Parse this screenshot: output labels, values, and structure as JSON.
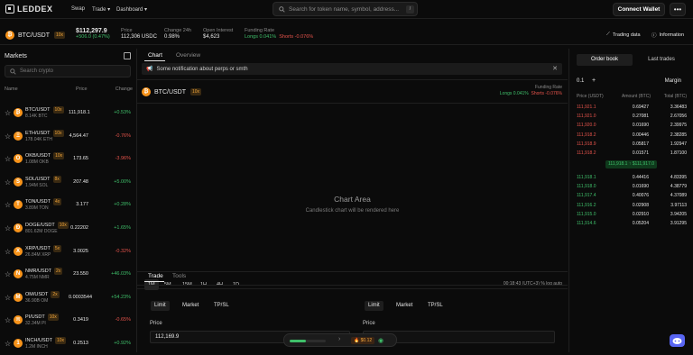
{
  "nav": {
    "brand": "LEDDEX",
    "links": [
      "Swap",
      "Trade",
      "Dashboard"
    ],
    "search_placeholder": "Search for token name, symbol, address...",
    "connect": "Connect Wallet",
    "more": "•••"
  },
  "ticker": {
    "pair": "BTC/USDT",
    "leverage": "10x",
    "price": "$112,297.9",
    "change": "+506.0 (0.47%)",
    "stats": [
      {
        "label": "Price",
        "value": "112,306 USDC"
      },
      {
        "label": "Change 24h",
        "value": "0.98%"
      },
      {
        "label": "Open Interest",
        "value": "$4,623"
      },
      {
        "label": "Funding Rate",
        "long": "Longs 0.041%",
        "short": "Shorts -0.076%"
      }
    ],
    "trading_data": "Trading data",
    "information": "Information"
  },
  "markets": {
    "title": "Markets",
    "search_placeholder": "Search crypto",
    "headers": {
      "name": "Name",
      "price": "Price",
      "change": "Change"
    },
    "rows": [
      {
        "sym": "BTC/USDT",
        "lev": "10x",
        "vol": "8.14K BTC",
        "price": "111,918.1",
        "chg": "+0.53%",
        "dir": "up",
        "color": "#f7931a",
        "glyph": "₿"
      },
      {
        "sym": "ETH/USDT",
        "lev": "10x",
        "vol": "178.04K ETH",
        "price": "4,564.47",
        "chg": "-0.76%",
        "dir": "down",
        "color": "#f7931a",
        "glyph": "Ξ"
      },
      {
        "sym": "OKB/USDT",
        "lev": "10x",
        "vol": "1.08M OKB",
        "price": "173.65",
        "chg": "-3.96%",
        "dir": "down",
        "color": "#f7931a",
        "glyph": "O"
      },
      {
        "sym": "SOL/USDT",
        "lev": "8x",
        "vol": "1.94M SOL",
        "price": "207.48",
        "chg": "+5.00%",
        "dir": "up",
        "color": "#f7931a",
        "glyph": "S"
      },
      {
        "sym": "TON/USDT",
        "lev": "4x",
        "vol": "3.89M TON",
        "price": "3.177",
        "chg": "+0.28%",
        "dir": "up",
        "color": "#f7931a",
        "glyph": "T"
      },
      {
        "sym": "DOGE/USDT",
        "lev": "10x",
        "vol": "801.62M DOGE",
        "price": "0.22202",
        "chg": "+1.65%",
        "dir": "up",
        "color": "#f7931a",
        "glyph": "Ð"
      },
      {
        "sym": "XRP/USDT",
        "lev": "5x",
        "vol": "26.84M XRP",
        "price": "3.0025",
        "chg": "-0.32%",
        "dir": "down",
        "color": "#f7931a",
        "glyph": "X"
      },
      {
        "sym": "NMR/USDT",
        "lev": "2x",
        "vol": "4.75M NMR",
        "price": "23.550",
        "chg": "+46.03%",
        "dir": "up",
        "color": "#f7931a",
        "glyph": "N"
      },
      {
        "sym": "OM/USDT",
        "lev": "2x",
        "vol": "36.90B OM",
        "price": "0.0003544",
        "chg": "+54.23%",
        "dir": "up",
        "color": "#f7931a",
        "glyph": "M"
      },
      {
        "sym": "PI/USDT",
        "lev": "10x",
        "vol": "32.34M PI",
        "price": "0.3419",
        "chg": "-0.65%",
        "dir": "down",
        "color": "#f7931a",
        "glyph": "π"
      },
      {
        "sym": "INCH/USDT",
        "lev": "10x",
        "vol": "1.2M INCH",
        "price": "0.2513",
        "chg": "+0.92%",
        "dir": "up",
        "color": "#f7931a",
        "glyph": "1"
      }
    ]
  },
  "main": {
    "tabs": [
      "Chart",
      "Overview"
    ],
    "notification": "Some notification about perps or smth",
    "chart_pair": "BTC/USDT",
    "chart_lev": "10x",
    "funding_label": "Funding Rate",
    "funding_long": "Longs 0.041%",
    "funding_short": "Shorts -0.076%",
    "chart_area_title": "Chart Area",
    "chart_area_sub": "Candlestick chart will be rendered here",
    "timeframes": [
      "1M",
      "5M",
      "15M",
      "1H",
      "4H",
      "1D"
    ],
    "time_status": "00:18:43 (UTC+3)  %  log  auto",
    "trade_tabs": [
      "Trade",
      "Tools"
    ],
    "order_types": [
      "Limit",
      "Market",
      "TP/SL"
    ],
    "price_label": "Price",
    "price_value": "112,169.9"
  },
  "orderbook": {
    "tabs": [
      "Order book",
      "Last trades"
    ],
    "step": "0.1",
    "plus": "+",
    "margin": "Margin",
    "headers": [
      "Price (USDT)",
      "Amount (BTC)",
      "Total (BTC)"
    ],
    "asks": [
      [
        "111,921.1",
        "0.69427",
        "3.36483"
      ],
      [
        "111,921.0",
        "0.27081",
        "2.67056"
      ],
      [
        "111,920.0",
        "0.01690",
        "2.39975"
      ],
      [
        "111,918.2",
        "0.00446",
        "2.38285"
      ],
      [
        "111,918.9",
        "0.05817",
        "1.92947"
      ],
      [
        "111,918.2",
        "0.01571",
        "1.87100"
      ]
    ],
    "mid_price": "111,918.1",
    "mid_mark": "$111,917.0",
    "bids": [
      [
        "111,918.1",
        "0.44416",
        "4.83395"
      ],
      [
        "111,918.0",
        "0.01690",
        "4.38779"
      ],
      [
        "111,917.4",
        "0.40076",
        "4.37089"
      ],
      [
        "111,916.2",
        "0.02908",
        "3.97113"
      ],
      [
        "111,915.0",
        "0.02910",
        "3.94205"
      ],
      [
        "111,914.6",
        "0.05204",
        "3.91295"
      ]
    ]
  },
  "dock": {
    "badge": "$0.12"
  }
}
